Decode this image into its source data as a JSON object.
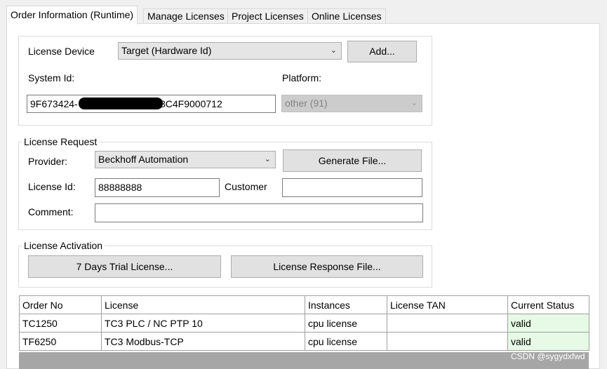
{
  "tabs": [
    {
      "label": "Order Information (Runtime)",
      "active": true
    },
    {
      "label": "Manage Licenses",
      "active": false
    },
    {
      "label": "Project Licenses",
      "active": false
    },
    {
      "label": "Online Licenses",
      "active": false
    }
  ],
  "device": {
    "license_device_label": "License Device",
    "license_device_value": "Target (Hardware Id)",
    "add_button": "Add...",
    "system_id_label": "System Id:",
    "system_id_prefix": "9F673424-",
    "system_id_suffix": "8C4F9000712",
    "platform_label": "Platform:",
    "platform_value": "other (91)"
  },
  "request": {
    "title": "License Request",
    "provider_label": "Provider:",
    "provider_value": "Beckhoff Automation",
    "generate_button": "Generate File...",
    "license_id_label": "License Id:",
    "license_id_value": "88888888",
    "customer_label": "Customer",
    "customer_value": "",
    "comment_label": "Comment:",
    "comment_value": ""
  },
  "activation": {
    "title": "License Activation",
    "trial_button": "7 Days Trial License...",
    "response_button": "License Response File..."
  },
  "table": {
    "columns": [
      "Order No",
      "License",
      "Instances",
      "License TAN",
      "Current Status"
    ],
    "rows": [
      [
        "TC1250",
        "TC3 PLC / NC PTP 10",
        "cpu license",
        "",
        "valid"
      ],
      [
        "TF6250",
        "TC3 Modbus-TCP",
        "cpu license",
        "",
        "valid"
      ]
    ],
    "valid_color": "#e6fae6"
  },
  "watermark": "CSDN @sygydxfwd"
}
